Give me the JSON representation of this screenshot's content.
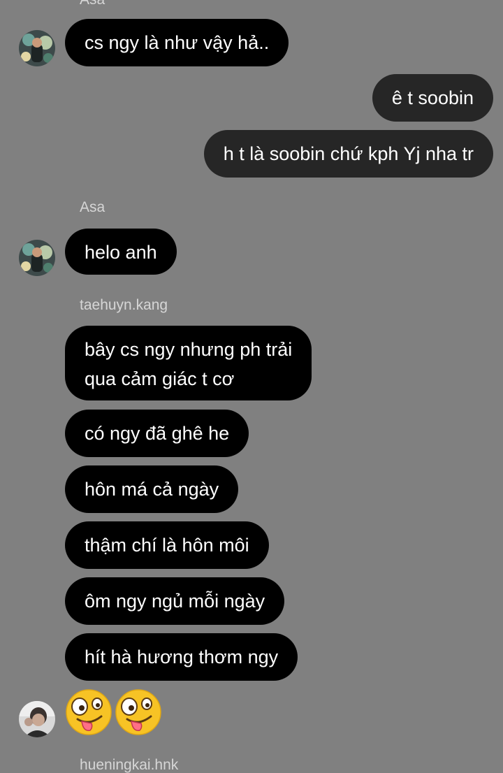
{
  "senders": {
    "top": "Asa",
    "asa": "Asa",
    "taehuyn": "taehuyn.kang",
    "hueningkai": "hueningkai.hnk"
  },
  "messages": {
    "m1": "cs ngy là như vậy hả..",
    "m2": "ê t soobin",
    "m3": "h t là soobin chứ kph Yj nha tr",
    "m4": "helo anh",
    "m5_line1": "bây cs ngy nhưng ph trải",
    "m5_line2": "qua cảm giác t cơ",
    "m6": "có ngy đã ghê he",
    "m7": "hôn má cả ngày",
    "m8": "thậm chí là hôn môi",
    "m9": "ôm ngy ngủ mỗi ngày",
    "m10": "hít hà hương thơm ngy"
  },
  "reaction": {
    "emoji": "🤪🤪",
    "icon": "zany-face-icon"
  },
  "colors": {
    "background": "#808080",
    "incoming_bubble": "#000000",
    "outgoing_bubble": "#262626",
    "bubble_text": "#ffffff",
    "sender_text": "#d6d6d6"
  }
}
